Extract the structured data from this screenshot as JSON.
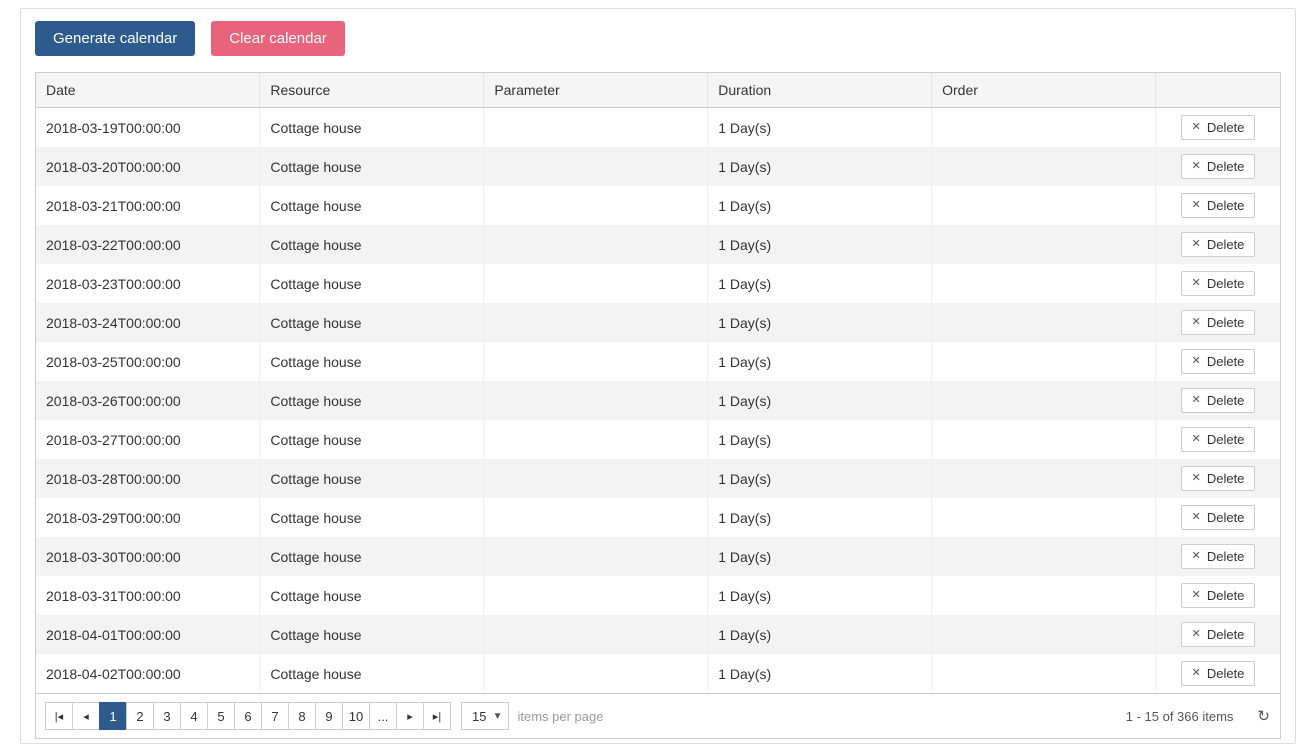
{
  "toolbar": {
    "generate_label": "Generate calendar",
    "clear_label": "Clear calendar"
  },
  "columns": {
    "date": "Date",
    "resource": "Resource",
    "parameter": "Parameter",
    "duration": "Duration",
    "order": "Order"
  },
  "delete_label": "Delete",
  "rows": [
    {
      "date": "2018-03-19T00:00:00",
      "resource": "Cottage house",
      "parameter": "",
      "duration": "1 Day(s)",
      "order": ""
    },
    {
      "date": "2018-03-20T00:00:00",
      "resource": "Cottage house",
      "parameter": "",
      "duration": "1 Day(s)",
      "order": ""
    },
    {
      "date": "2018-03-21T00:00:00",
      "resource": "Cottage house",
      "parameter": "",
      "duration": "1 Day(s)",
      "order": ""
    },
    {
      "date": "2018-03-22T00:00:00",
      "resource": "Cottage house",
      "parameter": "",
      "duration": "1 Day(s)",
      "order": ""
    },
    {
      "date": "2018-03-23T00:00:00",
      "resource": "Cottage house",
      "parameter": "",
      "duration": "1 Day(s)",
      "order": ""
    },
    {
      "date": "2018-03-24T00:00:00",
      "resource": "Cottage house",
      "parameter": "",
      "duration": "1 Day(s)",
      "order": ""
    },
    {
      "date": "2018-03-25T00:00:00",
      "resource": "Cottage house",
      "parameter": "",
      "duration": "1 Day(s)",
      "order": ""
    },
    {
      "date": "2018-03-26T00:00:00",
      "resource": "Cottage house",
      "parameter": "",
      "duration": "1 Day(s)",
      "order": ""
    },
    {
      "date": "2018-03-27T00:00:00",
      "resource": "Cottage house",
      "parameter": "",
      "duration": "1 Day(s)",
      "order": ""
    },
    {
      "date": "2018-03-28T00:00:00",
      "resource": "Cottage house",
      "parameter": "",
      "duration": "1 Day(s)",
      "order": ""
    },
    {
      "date": "2018-03-29T00:00:00",
      "resource": "Cottage house",
      "parameter": "",
      "duration": "1 Day(s)",
      "order": ""
    },
    {
      "date": "2018-03-30T00:00:00",
      "resource": "Cottage house",
      "parameter": "",
      "duration": "1 Day(s)",
      "order": ""
    },
    {
      "date": "2018-03-31T00:00:00",
      "resource": "Cottage house",
      "parameter": "",
      "duration": "1 Day(s)",
      "order": ""
    },
    {
      "date": "2018-04-01T00:00:00",
      "resource": "Cottage house",
      "parameter": "",
      "duration": "1 Day(s)",
      "order": ""
    },
    {
      "date": "2018-04-02T00:00:00",
      "resource": "Cottage house",
      "parameter": "",
      "duration": "1 Day(s)",
      "order": ""
    }
  ],
  "pager": {
    "pages": [
      "1",
      "2",
      "3",
      "4",
      "5",
      "6",
      "7",
      "8",
      "9",
      "10",
      "..."
    ],
    "active_page": "1",
    "page_size": "15",
    "items_per_page_label": "items per page",
    "info": "1 - 15 of 366 items"
  }
}
